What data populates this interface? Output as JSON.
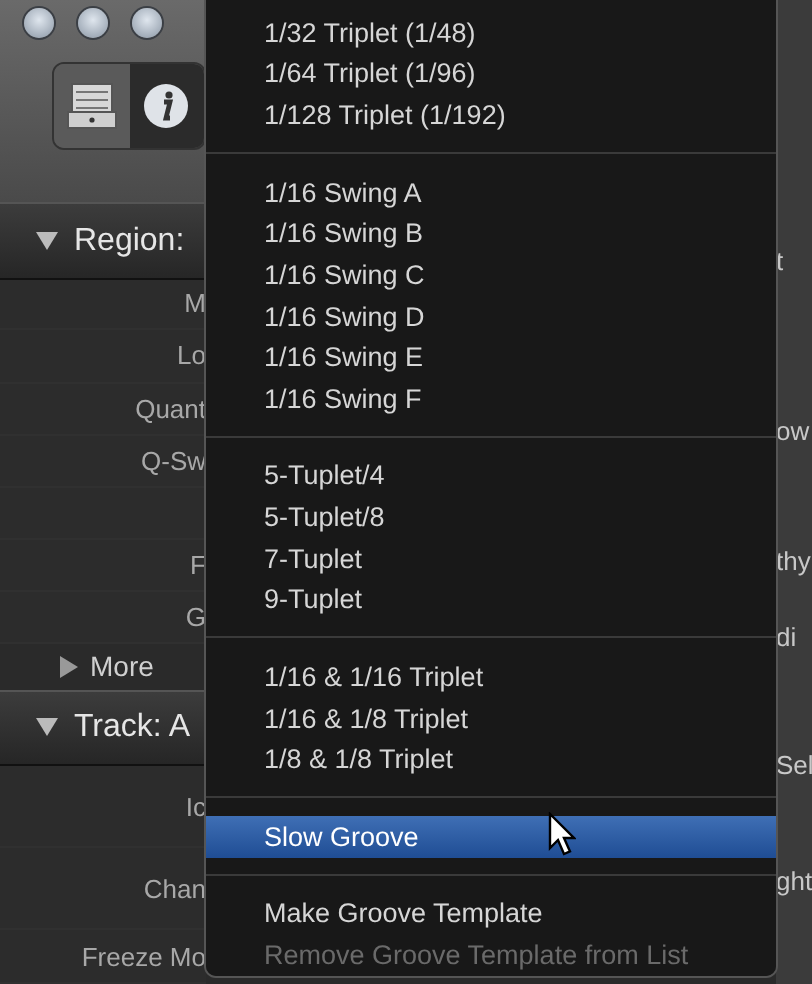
{
  "inspector": {
    "region_header": "Region:",
    "region_rows": [
      {
        "label": "M"
      },
      {
        "label": "Lo"
      },
      {
        "label": "Quant"
      },
      {
        "label": "Q-Sw"
      },
      {
        "kind": "blank"
      },
      {
        "label": "F"
      },
      {
        "label": "G"
      }
    ],
    "more": "More",
    "track_header": "Track:  A",
    "track_rows": [
      {
        "label": "Ic"
      },
      {
        "label": "Chan"
      },
      {
        "label": "Freeze Mo"
      }
    ]
  },
  "right_strip": [
    "t",
    "ow",
    "thy",
    "di",
    "Sel",
    "ght"
  ],
  "menu": {
    "groups": [
      [
        {
          "label": "1/32 Triplet (1/48)",
          "selected": false,
          "disabled": false
        },
        {
          "label": "1/64 Triplet (1/96)",
          "selected": false,
          "disabled": false
        },
        {
          "label": "1/128 Triplet (1/192)",
          "selected": false,
          "disabled": false
        }
      ],
      [
        {
          "label": "1/16 Swing A",
          "selected": false,
          "disabled": false
        },
        {
          "label": "1/16 Swing B",
          "selected": false,
          "disabled": false
        },
        {
          "label": "1/16 Swing C",
          "selected": false,
          "disabled": false
        },
        {
          "label": "1/16 Swing D",
          "selected": false,
          "disabled": false
        },
        {
          "label": "1/16 Swing E",
          "selected": false,
          "disabled": false
        },
        {
          "label": "1/16 Swing F",
          "selected": false,
          "disabled": false
        }
      ],
      [
        {
          "label": "5-Tuplet/4",
          "selected": false,
          "disabled": false
        },
        {
          "label": "5-Tuplet/8",
          "selected": false,
          "disabled": false
        },
        {
          "label": "7-Tuplet",
          "selected": false,
          "disabled": false
        },
        {
          "label": "9-Tuplet",
          "selected": false,
          "disabled": false
        }
      ],
      [
        {
          "label": "1/16 & 1/16 Triplet",
          "selected": false,
          "disabled": false
        },
        {
          "label": "1/16 & 1/8 Triplet",
          "selected": false,
          "disabled": false
        },
        {
          "label": "1/8 & 1/8 Triplet",
          "selected": false,
          "disabled": false
        }
      ],
      [
        {
          "label": "Slow Groove",
          "selected": true,
          "disabled": false
        }
      ],
      [
        {
          "label": "Make Groove Template",
          "selected": false,
          "disabled": false
        },
        {
          "label": "Remove Groove Template from List",
          "selected": false,
          "disabled": true
        }
      ]
    ]
  }
}
